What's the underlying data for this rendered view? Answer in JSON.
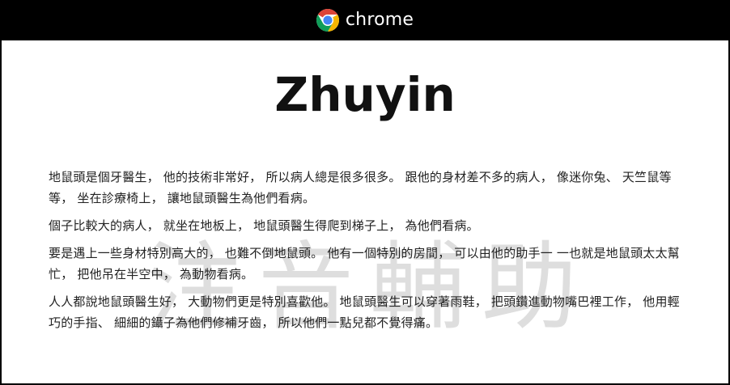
{
  "brand": {
    "name": "chrome"
  },
  "page": {
    "title": "Zhuyin",
    "watermark": "注音輔助",
    "paragraphs": [
      "地鼠頭是個牙醫生， 他的技術非常好， 所以病人總是很多很多。 跟他的身材差不多的病人， 像迷你兔、 天竺鼠等等， 坐在診療椅上， 讓地鼠頭醫生為他們看病。",
      "個子比較大的病人， 就坐在地板上， 地鼠頭醫生得爬到梯子上， 為他們看病。",
      "要是遇上一些身材特別高大的， 也難不倒地鼠頭。 他有一個特別的房間， 可以由他的助手一 一也就是地鼠頭太太幫忙， 把他吊在半空中， 為動物看病。",
      "人人都說地鼠頭醫生好， 大動物們更是特別喜歡他。 地鼠頭醫生可以穿著雨鞋， 把頭鑽進動物嘴巴裡工作， 他用輕巧的手指、 細細的鑷子為他們修補牙齒， 所以他們一點兒都不覺得痛。"
    ]
  },
  "colors": {
    "bar": "#000000",
    "chrome_red": "#DB4437",
    "chrome_yellow": "#F4B400",
    "chrome_green": "#0F9D58",
    "chrome_blue": "#4285F4"
  },
  "icons": {
    "logo": "chrome-logo-icon"
  }
}
